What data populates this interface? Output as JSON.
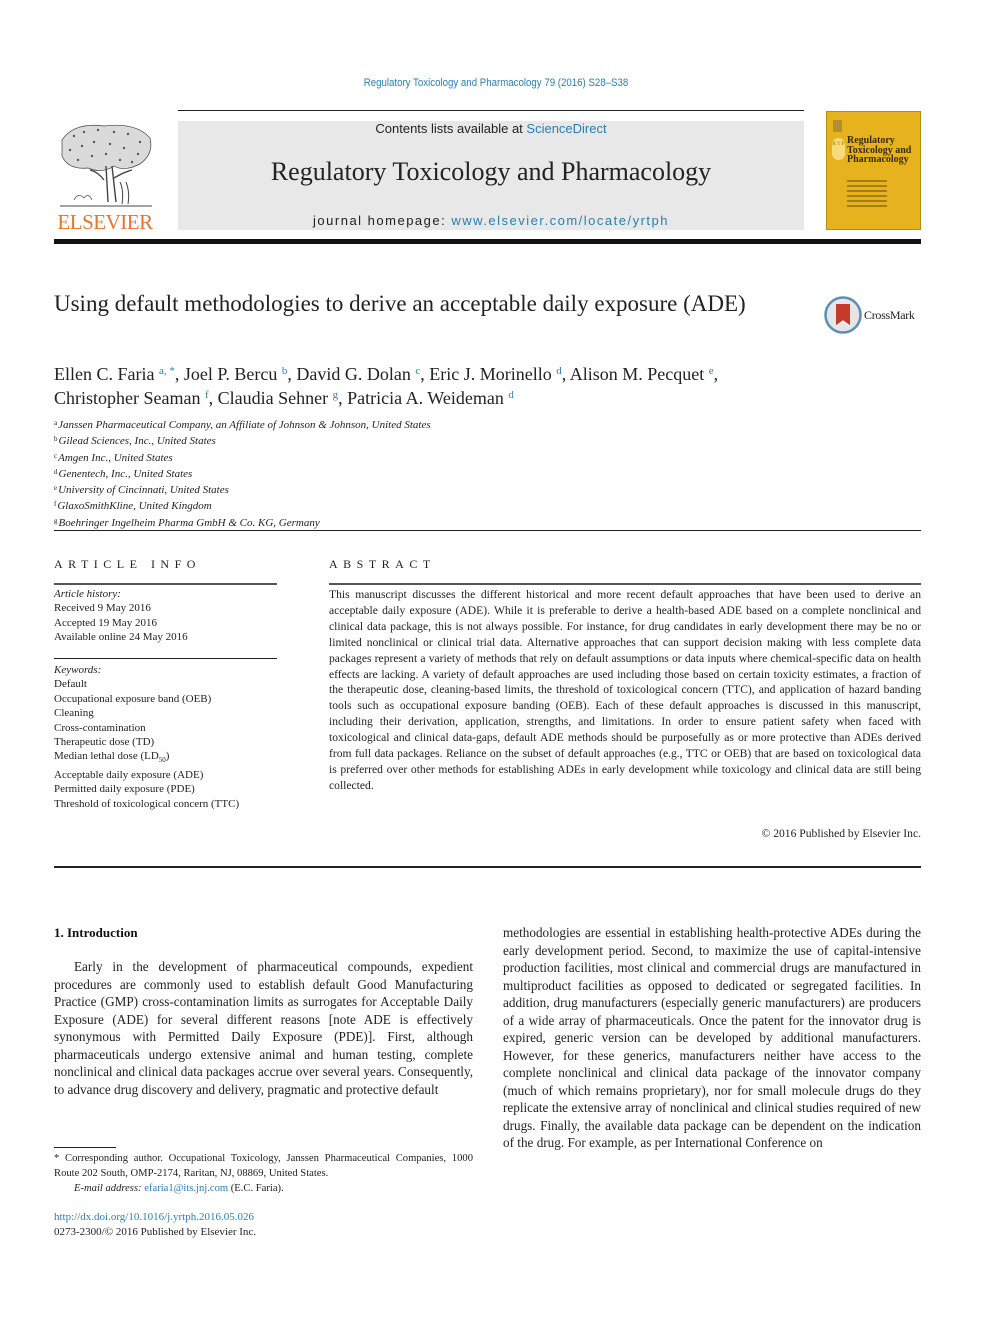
{
  "header": {
    "citation": "Regulatory Toxicology and Pharmacology 79 (2016) S28–S38",
    "contents_prefix": "Contents lists available at ",
    "contents_link": "ScienceDirect",
    "journal_name": "Regulatory Toxicology and Pharmacology",
    "homepage_prefix": "journal homepage: ",
    "homepage_link": "www.elsevier.com/locate/yrtph",
    "publisher_logo_text": "ELSEVIER",
    "cover": {
      "title": "Regulatory Toxicology and Pharmacology",
      "badge": "R T P",
      "color": "#e6b21e"
    },
    "accent_color": "#2a7fb0",
    "elsevier_color": "#e8732a"
  },
  "article": {
    "title": "Using default methodologies to derive an acceptable daily exposure (ADE)",
    "crossmark_label": "CrossMark",
    "authors": [
      {
        "name": "Ellen C. Faria",
        "sup": "a, *",
        "sep": ", "
      },
      {
        "name": "Joel P. Bercu",
        "sup": "b",
        "sep": ", "
      },
      {
        "name": "David G. Dolan",
        "sup": "c",
        "sep": ", "
      },
      {
        "name": "Eric J. Morinello",
        "sup": "d",
        "sep": ", "
      },
      {
        "name": "Alison M. Pecquet",
        "sup": "e",
        "sep": ","
      },
      {
        "name": "Christopher Seaman",
        "sup": "f",
        "sep": ", "
      },
      {
        "name": "Claudia Sehner",
        "sup": "g",
        "sep": ", "
      },
      {
        "name": "Patricia A. Weideman",
        "sup": "d",
        "sep": ""
      }
    ],
    "affiliations": [
      {
        "key": "a",
        "text": "Janssen Pharmaceutical Company, an Affiliate of Johnson & Johnson, United States"
      },
      {
        "key": "b",
        "text": "Gilead Sciences, Inc., United States"
      },
      {
        "key": "c",
        "text": "Amgen Inc., United States"
      },
      {
        "key": "d",
        "text": "Genentech, Inc., United States"
      },
      {
        "key": "e",
        "text": "University of Cincinnati, United States"
      },
      {
        "key": "f",
        "text": "GlaxoSmithKline, United Kingdom"
      },
      {
        "key": "g",
        "text": "Boehringer Ingelheim Pharma GmbH & Co. KG, Germany"
      }
    ]
  },
  "article_info": {
    "heading": "ARTICLE INFO",
    "history_label": "Article history:",
    "history": [
      "Received 9 May 2016",
      "Accepted 19 May 2016",
      "Available online 24 May 2016"
    ],
    "keywords_label": "Keywords:",
    "keywords": [
      "Default",
      "Occupational exposure band (OEB)",
      "Cleaning",
      "Cross-contamination",
      "Therapeutic dose (TD)",
      "Median lethal dose (LD50)",
      "Acceptable daily exposure (ADE)",
      "Permitted daily exposure (PDE)",
      "Threshold of toxicological concern (TTC)"
    ]
  },
  "abstract": {
    "heading": "ABSTRACT",
    "text": "This manuscript discusses the different historical and more recent default approaches that have been used to derive an acceptable daily exposure (ADE). While it is preferable to derive a health-based ADE based on a complete nonclinical and clinical data package, this is not always possible. For instance, for drug candidates in early development there may be no or limited nonclinical or clinical trial data. Alternative approaches that can support decision making with less complete data packages represent a variety of methods that rely on default assumptions or data inputs where chemical-specific data on health effects are lacking. A variety of default approaches are used including those based on certain toxicity estimates, a fraction of the therapeutic dose, cleaning-based limits, the threshold of toxicological concern (TTC), and application of hazard banding tools such as occupational exposure banding (OEB). Each of these default approaches is discussed in this manuscript, including their derivation, application, strengths, and limitations. In order to ensure patient safety when faced with toxicological and clinical data-gaps, default ADE methods should be purposefully as or more protective than ADEs derived from full data packages. Reliance on the subset of default approaches (e.g., TTC or OEB) that are based on toxicological data is preferred over other methods for establishing ADEs in early development while toxicology and clinical data are still being collected.",
    "copyright": "© 2016 Published by Elsevier Inc."
  },
  "body": {
    "section_title": "1.  Introduction",
    "left_paragraph": "Early in the development of pharmaceutical compounds, expedient procedures are commonly used to establish default Good Manufacturing Practice (GMP) cross-contamination limits as surrogates for Acceptable Daily Exposure (ADE) for several different reasons [note ADE is effectively synonymous with Permitted Daily Exposure (PDE)]. First, although pharmaceuticals undergo extensive animal and human testing, complete nonclinical and clinical data packages accrue over several years. Consequently, to advance drug discovery and delivery, pragmatic and protective default",
    "right_paragraph": "methodologies are essential in establishing health-protective ADEs during the early development period. Second, to maximize the use of capital-intensive production facilities, most clinical and commercial drugs are manufactured in multiproduct facilities as opposed to dedicated or segregated facilities. In addition, drug manufacturers (especially generic manufacturers) are producers of a wide array of pharmaceuticals. Once the patent for the innovator drug is expired, generic version can be developed by additional manufacturers. However, for these generics, manufacturers neither have access to the complete nonclinical and clinical data package of the innovator company (much of which remains proprietary), nor for small molecule drugs do they replicate the extensive array of nonclinical and clinical studies required of new drugs. Finally, the available data package can be dependent on the indication of the drug. For example, as per International Conference on"
  },
  "footnotes": {
    "corresponding": "* Corresponding author. Occupational Toxicology, Janssen Pharmaceutical Companies, 1000 Route 202 South, OMP-2174, Raritan, NJ, 08869, United States.",
    "email_label": "E-mail address: ",
    "email": "efaria1@its.jnj.com",
    "email_suffix": " (E.C. Faria).",
    "doi": "http://dx.doi.org/10.1016/j.yrtph.2016.05.026",
    "issn": "0273-2300/© 2016 Published by Elsevier Inc."
  }
}
